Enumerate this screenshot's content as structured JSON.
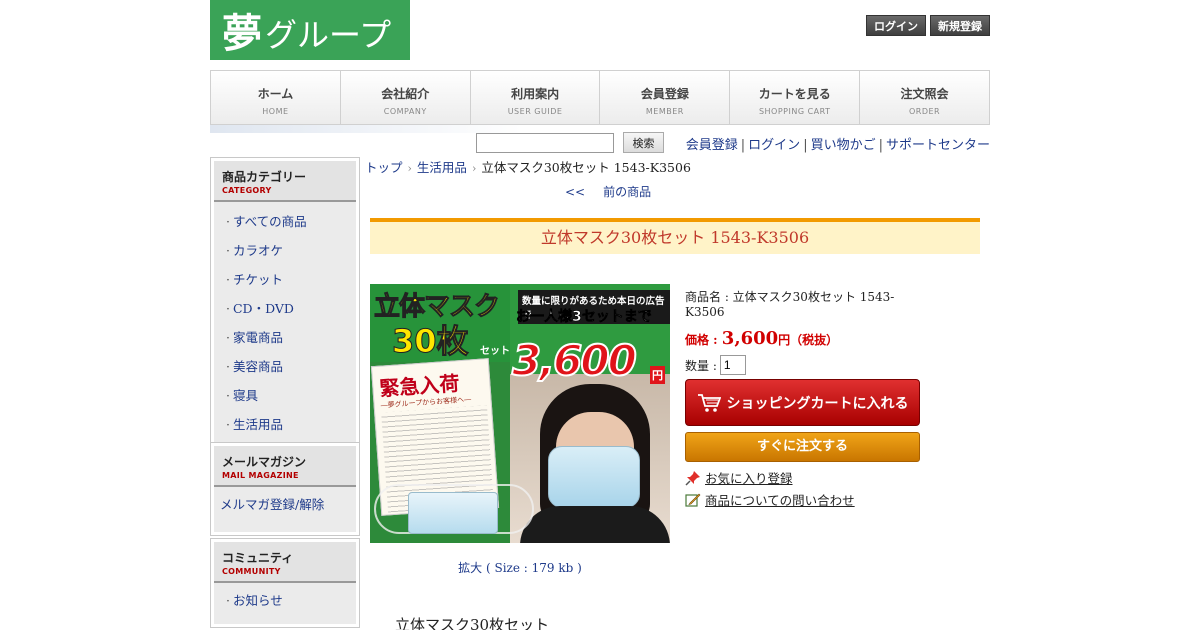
{
  "header": {
    "logo_main": "夢",
    "logo_sub": "グループ",
    "login_label": "ログイン",
    "register_label": "新規登録"
  },
  "nav": [
    {
      "jp": "ホーム",
      "en": "HOME"
    },
    {
      "jp": "会社紹介",
      "en": "COMPANY"
    },
    {
      "jp": "利用案内",
      "en": "USER GUIDE"
    },
    {
      "jp": "会員登録",
      "en": "MEMBER"
    },
    {
      "jp": "カートを見る",
      "en": "SHOPPING CART"
    },
    {
      "jp": "注文照会",
      "en": "ORDER"
    }
  ],
  "search": {
    "value": "",
    "button_label": "検索"
  },
  "toplinks": [
    "会員登録",
    "ログイン",
    "買い物かご",
    "サポートセンター"
  ],
  "sidebar": {
    "category": {
      "title": "商品カテゴリー",
      "sub": "CATEGORY",
      "items": [
        "すべての商品",
        "カラオケ",
        "チケット",
        "CD・DVD",
        "家電商品",
        "美容商品",
        "寝具",
        "生活用品"
      ]
    },
    "mail": {
      "title": "メールマガジン",
      "sub": "MAIL MAGAZINE",
      "items": [
        "メルマガ登録/解除"
      ]
    },
    "community": {
      "title": "コミュニティ",
      "sub": "COMMUNITY",
      "items": [
        "お知らせ"
      ]
    }
  },
  "breadcrumb": {
    "home": "トップ",
    "category": "生活用品",
    "current": "立体マスク30枚セット 1543-K3506"
  },
  "prevnext": {
    "arrows": "<<",
    "prev_label": "前の商品"
  },
  "product": {
    "title": "立体マスク30枚セット 1543-K3506",
    "image": {
      "headline1": "立体マスク",
      "headline2": "30枚",
      "headline3": "セット",
      "promo_top": "数量に限りがあるため本日の広告で",
      "promo_main": "お一人様3セットまで",
      "price": "3,600",
      "yen": "円",
      "notice_title": "緊急入荷",
      "notice_sub": "―夢グループからお客様へ―"
    },
    "zoom_label": "拡大 ( Size : 179 kb )",
    "name_line": "商品名 : 立体マスク30枚セット 1543-K3506",
    "price_label": "価格 : ",
    "price_value": "3,600",
    "price_suffix": "円（税抜）",
    "qty_label": "数量 : ",
    "qty_value": "1",
    "cart_button": "ショッピングカートに入れる",
    "buy_button": "すぐに注文する",
    "fav_link": "お気に入り登録",
    "inquiry_link": "商品についての問い合わせ",
    "description_title": "立体マスク30枚セット"
  },
  "colors": {
    "logo_green": "#3aa357",
    "accent_orange": "#f29a00",
    "price_red": "#d10000",
    "cart_red": "#c01a1a",
    "buy_orange": "#e08c10",
    "link_blue": "#1e3a8a"
  }
}
